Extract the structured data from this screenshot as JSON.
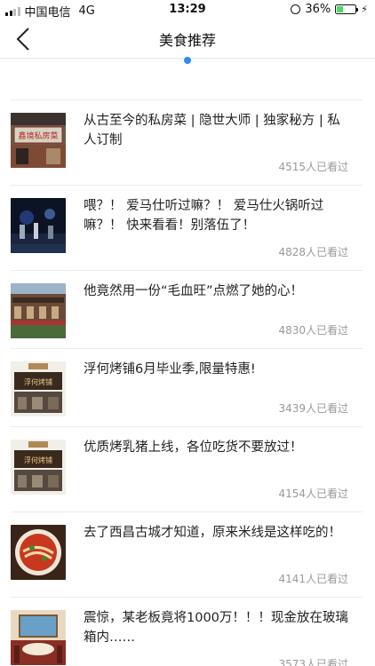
{
  "status_bar": {
    "carrier": "中国电信",
    "network": "4G",
    "time": "13:29",
    "battery": "36%",
    "battery_level": 0.36,
    "battery_color": "#4cd964"
  },
  "nav": {
    "title": "美食推荐",
    "back_icon": "chevron-left-icon"
  },
  "pager": {
    "active_color": "#2d8cf0"
  },
  "articles": [
    {
      "title": "从古至今的私房菜 | 隐世大师 | 独家秘方 | 私人订制",
      "views": "4515人已看过",
      "image": "restaurant-sign"
    },
    {
      "title": "喂？！ 爱马仕听过嘛？！ 爱马仕火锅听过嘛？！ 快来看看！别落伍了！",
      "views": "4828人已看过",
      "image": "night-stage"
    },
    {
      "title": "他竟然用一份“毛血旺”点燃了她的心！",
      "views": "4830人已看过",
      "image": "old-building"
    },
    {
      "title": "浮何烤铺6月毕业季,限量特惠!",
      "views": "3439人已看过",
      "image": "bbq-shop"
    },
    {
      "title": "优质烤乳猪上线，各位吃货不要放过！",
      "views": "4154人已看过",
      "image": "bbq-shop"
    },
    {
      "title": "去了西昌古城才知道，原来米线是这样吃的！",
      "views": "4141人已看过",
      "image": "noodle-bowl"
    },
    {
      "title": "震惊，某老板竟将1000万！！！现金放在玻璃箱内……",
      "views": "3573人已看过",
      "image": "dining-room"
    }
  ]
}
